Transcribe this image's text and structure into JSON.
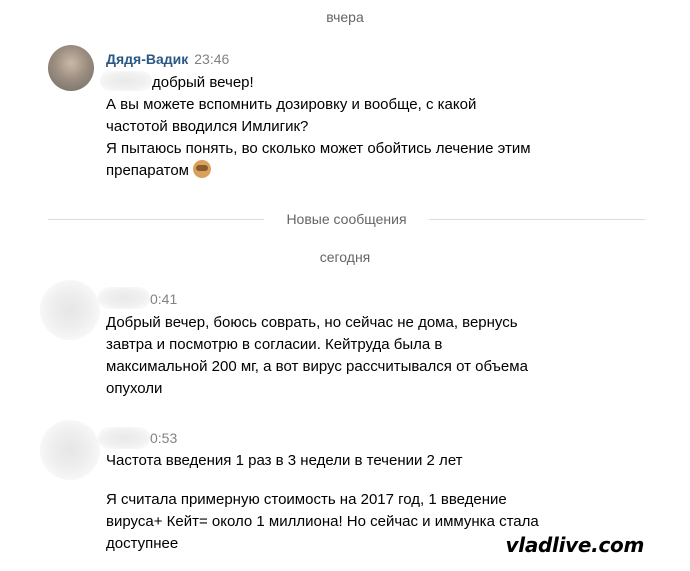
{
  "date_labels": {
    "yesterday": "вчера",
    "today": "сегодня"
  },
  "new_messages_label": "Новые сообщения",
  "messages": [
    {
      "sender": "Дядя-Вадик",
      "time": "23:46",
      "lines": [
        "добрый вечер!",
        "А вы можете вспомнить дозировку и вообще, с какой",
        "частотой вводился Имлигик?",
        "Я пытаюсь понять, во сколько может обойтись лечение этим",
        "препаратом"
      ],
      "emoji": "see-no-evil-monkey"
    },
    {
      "time": "0:41",
      "lines": [
        "Добрый вечер, боюсь соврать, но сейчас не дома, вернусь",
        "завтра и посмотрю в согласии. Кейтруда была в",
        "максимальной 200 мг, а вот вирус рассчитывался от объема",
        "опухоли"
      ]
    },
    {
      "time": "0:53",
      "lines": [
        "Частота введения 1 раз в 3 недели в течении 2 лет"
      ],
      "lines2": [
        "Я считала примерную стоимость на 2017 год, 1 введение",
        "вируса+ Кейт= около 1 миллиона! Но сейчас и иммунка стала",
        "доступнее"
      ]
    }
  ],
  "watermark": "vladlive.com"
}
